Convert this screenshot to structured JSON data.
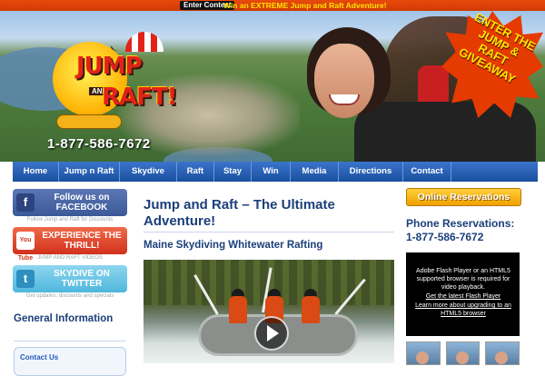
{
  "contest_bar": {
    "button": "Enter Contest",
    "text": "Win an EXTREME Jump and Raft Adventure!"
  },
  "hero": {
    "logo_jump": "JUMP",
    "logo_and": "AND",
    "logo_raft": "RAFT!",
    "phone": "1-877-586-7672",
    "burst": "ENTER THE JUMP & RAFT GIVEAWAY"
  },
  "nav": {
    "items": [
      "Home",
      "Jump n Raft",
      "Skydive",
      "Raft",
      "Stay",
      "Win",
      "Media",
      "Directions",
      "Contact"
    ]
  },
  "sidebar": {
    "facebook": {
      "label": "Follow us on FACEBOOK",
      "sub": "Follow Jump and Raft for Discounts"
    },
    "youtube": {
      "icon_text": "You Tube",
      "label": "EXPERIENCE THE THRILL!",
      "sub": "JUMP AND RAFT VIDEOS"
    },
    "twitter": {
      "label": "SKYDIVE ON TWITTER",
      "sub": "Get updates, discounts and specials"
    },
    "general_info": "General Information",
    "contact_link": "Contact Us"
  },
  "main": {
    "title": "Jump and Raft – The Ultimate Adventure!",
    "subtitle": "Maine Skydiving Whitewater Rafting"
  },
  "right": {
    "reserve_button": "Online Reservations",
    "phone_label": "Phone Reservations:",
    "phone_number": "1-877-586-7672",
    "flash_text": "Adobe Flash Player or an HTML5 supported browser is required for video playback.",
    "flash_link1": "Get the latest Flash Player",
    "flash_link2": "Learn more about upgrading to an HTML5 browser"
  },
  "colors": {
    "nav_blue": "#1a4f9e",
    "heading_blue": "#1b3f7a",
    "accent_orange": "#e84a0c",
    "reserve_gold": "#f0a000"
  }
}
